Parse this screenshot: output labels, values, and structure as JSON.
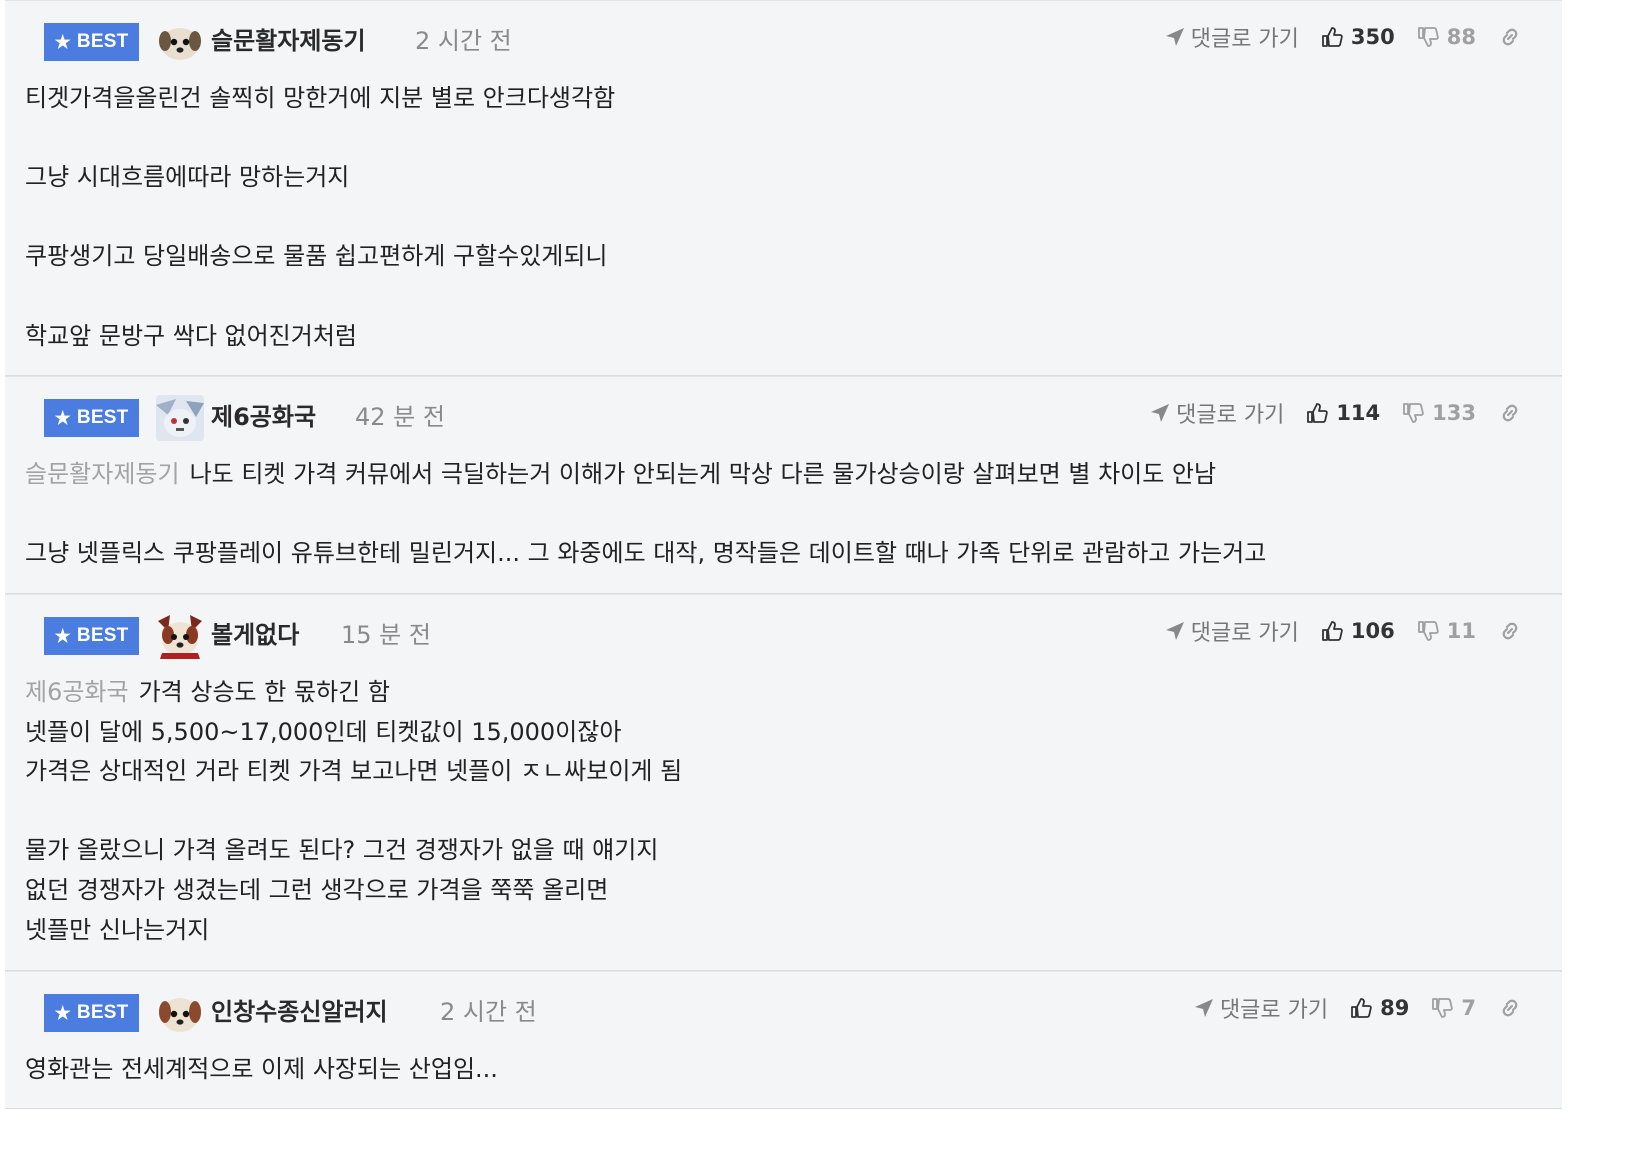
{
  "best_label": "BEST",
  "reply_label": "댓글로 가기",
  "comments": [
    {
      "nickname": "슬문활자제동기",
      "time": "2 시간 전",
      "likes": "350",
      "dislikes": "88",
      "mention": "",
      "lines": [
        "티겟가격을올린건 솔찍히 망한거에 지분 별로 안크다생각함",
        "",
        "그냥 시대흐름에따라 망하는거지",
        "",
        "쿠팡생기고 당일배송으로 물품 쉽고편하게 구할수있게되니",
        "",
        "학교앞 문방구 싹다 없어진거처럼"
      ]
    },
    {
      "nickname": "제6공화국",
      "time": "42 분 전",
      "likes": "114",
      "dislikes": "133",
      "mention": "슬문활자제동기",
      "lines": [
        "나도 티켓 가격 커뮤에서 극딜하는거 이해가 안되는게 막상 다른 물가상승이랑 살펴보면 별 차이도 안남",
        "",
        "그냥 넷플릭스 쿠팡플레이 유튜브한테 밀린거지... 그 와중에도 대작, 명작들은 데이트할 때나 가족 단위로 관람하고 가는거고"
      ]
    },
    {
      "nickname": "볼게없다",
      "time": "15 분 전",
      "likes": "106",
      "dislikes": "11",
      "mention": "제6공화국",
      "lines": [
        "가격 상승도 한 몫하긴 함",
        "넷플이 달에 5,500~17,000인데 티켓값이 15,000이잖아",
        "가격은 상대적인 거라 티켓 가격 보고나면 넷플이 ㅈㄴ싸보이게 됨",
        "",
        "물가 올랐으니 가격 올려도 된다? 그건 경쟁자가 없을 때 얘기지",
        "없던 경쟁자가 생겼는데 그런 생각으로 가격을 쭉쭉 올리면",
        "넷플만 신나는거지"
      ]
    },
    {
      "nickname": "인창수종신알러지",
      "time": "2 시간 전",
      "likes": "89",
      "dislikes": "7",
      "mention": "",
      "lines": [
        "영화관는 전세계적으로 이제 사장되는 산업임..."
      ]
    }
  ],
  "icons": {
    "badge": "star-icon",
    "reply": "send-arrow-icon",
    "like": "thumbs-up-icon",
    "dislike": "thumbs-down-icon",
    "link": "link-icon",
    "avatar": "dog-avatar"
  },
  "colors": {
    "badge": "#4a7ddf",
    "card_bg": "#f4f5f7",
    "mention": "#a3a3a3",
    "time": "#8a8a8a"
  }
}
